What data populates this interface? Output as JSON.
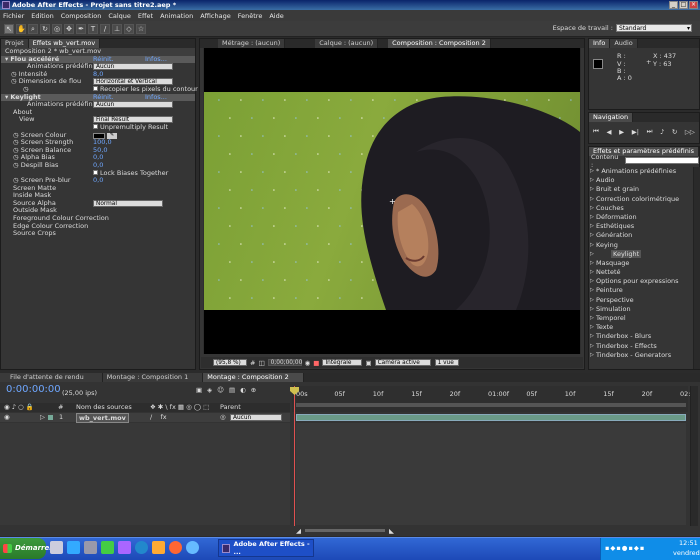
{
  "window": {
    "title": "Adobe After Effects - Projet sans titre2.aep *"
  },
  "menu": [
    "Fichier",
    "Edition",
    "Composition",
    "Calque",
    "Effet",
    "Animation",
    "Affichage",
    "Fenêtre",
    "Aide"
  ],
  "workspace": {
    "label": "Espace de travail :",
    "value": "Standard"
  },
  "left_panel": {
    "tabs": [
      "Projet",
      "Effets wb_vert.mov"
    ],
    "header": "Composition 2 * wb_vert.mov",
    "flou": {
      "name": "Flou accéléré",
      "reset": "Réinit.",
      "info": "Infos...",
      "presets_label": "Animations prédéfinies :",
      "presets_value": "Aucun",
      "intensity_label": "Intensité",
      "intensity_value": "8,0",
      "dims_label": "Dimensions de flou",
      "dims_value": "Horizontal et Vertical",
      "repeat_label": "Recopier les pixels du contour"
    },
    "keylight": {
      "name": "Keylight",
      "reset": "Réinit.",
      "info": "Infos...",
      "presets_label": "Animations prédéfinies :",
      "presets_value": "Aucun",
      "about": "About",
      "view_label": "View",
      "view_value": "Final Result",
      "unpremultiply": "Unpremultiply Result",
      "screen_colour": "Screen Colour",
      "screen_strength_label": "Screen Strength",
      "screen_strength_value": "100,0",
      "screen_balance_label": "Screen Balance",
      "screen_balance_value": "50,0",
      "alpha_bias_label": "Alpha Bias",
      "alpha_bias_value": "0,0",
      "despill_label": "Despill Bias",
      "despill_value": "0,0",
      "lock_biases": "Lock Biases Together",
      "preblur_label": "Screen Pre-blur",
      "preblur_value": "0,0",
      "screen_matte": "Screen Matte",
      "inside_mask": "Inside Mask",
      "source_alpha_label": "Source Alpha",
      "source_alpha_value": "Normal",
      "outside_mask": "Outside Mask",
      "fg_colour": "Foreground Colour Correction",
      "edge_colour": "Edge Colour Correction",
      "source_crops": "Source Crops"
    }
  },
  "viewer": {
    "tabs": [
      "Métrage : (aucun)",
      "Calque : (aucun)",
      "Composition : Composition 2"
    ],
    "zoom": "(95,8 %)",
    "timecode": "0;00;00;00",
    "resolution": "Intégrale",
    "camera": "Caméra active",
    "views": "1 vue"
  },
  "info_panel": {
    "tabs": [
      "Info",
      "Audio"
    ],
    "r": "R :",
    "v": "V :",
    "b": "B :",
    "a": "A : 0",
    "x": "X : 437",
    "y": "Y : 63"
  },
  "navigation": {
    "title": "Navigation"
  },
  "effects_panel": {
    "title": "Effets et paramètres prédéfinis",
    "contents_label": "Contenu :",
    "items": [
      "* Animations prédéfinies",
      "Audio",
      "Bruit et grain",
      "Correction colorimétrique",
      "Couches",
      "Déformation",
      "Esthétiques",
      "Génération",
      "Keying",
      "Masquage",
      "Netteté",
      "Options pour expressions",
      "Peinture",
      "Perspective",
      "Simulation",
      "Temporel",
      "Texte",
      "Tinderbox - Blurs",
      "Tinderbox - Effects",
      "Tinderbox - Generators"
    ],
    "sub_item": "Keylight"
  },
  "timeline": {
    "tabs": [
      "File d'attente de rendu",
      "Montage : Composition 1",
      "Montage : Composition 2"
    ],
    "timecode": "0:00:00:00",
    "fps": "(25,00 ips)",
    "col_hash": "#",
    "col_source": "Nom des sources",
    "col_parent": "Parent",
    "layer_index": "1",
    "layer_name": "wb_vert.mov",
    "layer_parent": "Aucun",
    "ticks": [
      "00s",
      "05f",
      "10f",
      "15f",
      "20f",
      "01:00f",
      "05f",
      "10f",
      "15f",
      "20f",
      "02:0"
    ]
  },
  "taskbar": {
    "start": "Démarrer",
    "task": "Adobe After Effects - ...",
    "clock": "12:51",
    "day": "vendredi"
  },
  "colors": {
    "accent_blue": "#6fa7ff",
    "chroma_green": "#7ba035",
    "taskbar": "#245edb"
  }
}
